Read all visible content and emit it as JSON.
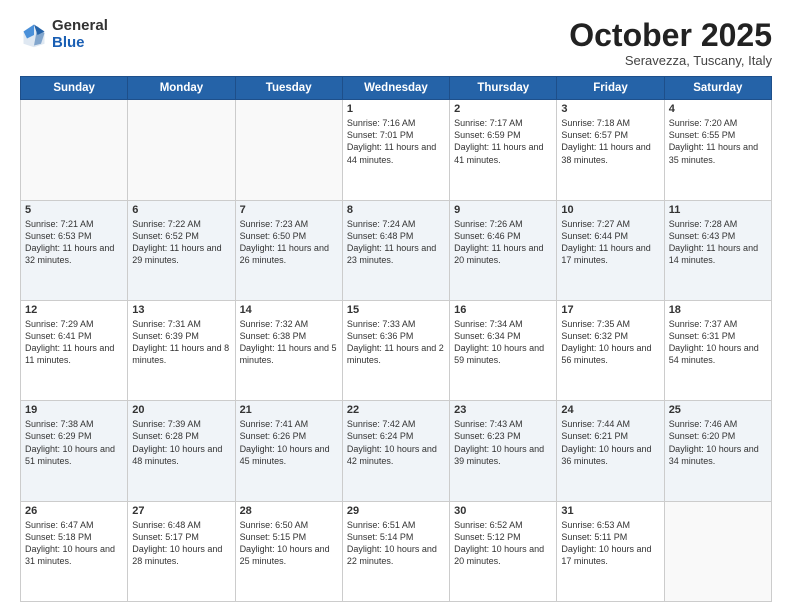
{
  "header": {
    "logo_general": "General",
    "logo_blue": "Blue",
    "month": "October 2025",
    "location": "Seravezza, Tuscany, Italy"
  },
  "weekdays": [
    "Sunday",
    "Monday",
    "Tuesday",
    "Wednesday",
    "Thursday",
    "Friday",
    "Saturday"
  ],
  "weeks": [
    [
      {
        "day": "",
        "info": ""
      },
      {
        "day": "",
        "info": ""
      },
      {
        "day": "",
        "info": ""
      },
      {
        "day": "1",
        "info": "Sunrise: 7:16 AM\nSunset: 7:01 PM\nDaylight: 11 hours and 44 minutes."
      },
      {
        "day": "2",
        "info": "Sunrise: 7:17 AM\nSunset: 6:59 PM\nDaylight: 11 hours and 41 minutes."
      },
      {
        "day": "3",
        "info": "Sunrise: 7:18 AM\nSunset: 6:57 PM\nDaylight: 11 hours and 38 minutes."
      },
      {
        "day": "4",
        "info": "Sunrise: 7:20 AM\nSunset: 6:55 PM\nDaylight: 11 hours and 35 minutes."
      }
    ],
    [
      {
        "day": "5",
        "info": "Sunrise: 7:21 AM\nSunset: 6:53 PM\nDaylight: 11 hours and 32 minutes."
      },
      {
        "day": "6",
        "info": "Sunrise: 7:22 AM\nSunset: 6:52 PM\nDaylight: 11 hours and 29 minutes."
      },
      {
        "day": "7",
        "info": "Sunrise: 7:23 AM\nSunset: 6:50 PM\nDaylight: 11 hours and 26 minutes."
      },
      {
        "day": "8",
        "info": "Sunrise: 7:24 AM\nSunset: 6:48 PM\nDaylight: 11 hours and 23 minutes."
      },
      {
        "day": "9",
        "info": "Sunrise: 7:26 AM\nSunset: 6:46 PM\nDaylight: 11 hours and 20 minutes."
      },
      {
        "day": "10",
        "info": "Sunrise: 7:27 AM\nSunset: 6:44 PM\nDaylight: 11 hours and 17 minutes."
      },
      {
        "day": "11",
        "info": "Sunrise: 7:28 AM\nSunset: 6:43 PM\nDaylight: 11 hours and 14 minutes."
      }
    ],
    [
      {
        "day": "12",
        "info": "Sunrise: 7:29 AM\nSunset: 6:41 PM\nDaylight: 11 hours and 11 minutes."
      },
      {
        "day": "13",
        "info": "Sunrise: 7:31 AM\nSunset: 6:39 PM\nDaylight: 11 hours and 8 minutes."
      },
      {
        "day": "14",
        "info": "Sunrise: 7:32 AM\nSunset: 6:38 PM\nDaylight: 11 hours and 5 minutes."
      },
      {
        "day": "15",
        "info": "Sunrise: 7:33 AM\nSunset: 6:36 PM\nDaylight: 11 hours and 2 minutes."
      },
      {
        "day": "16",
        "info": "Sunrise: 7:34 AM\nSunset: 6:34 PM\nDaylight: 10 hours and 59 minutes."
      },
      {
        "day": "17",
        "info": "Sunrise: 7:35 AM\nSunset: 6:32 PM\nDaylight: 10 hours and 56 minutes."
      },
      {
        "day": "18",
        "info": "Sunrise: 7:37 AM\nSunset: 6:31 PM\nDaylight: 10 hours and 54 minutes."
      }
    ],
    [
      {
        "day": "19",
        "info": "Sunrise: 7:38 AM\nSunset: 6:29 PM\nDaylight: 10 hours and 51 minutes."
      },
      {
        "day": "20",
        "info": "Sunrise: 7:39 AM\nSunset: 6:28 PM\nDaylight: 10 hours and 48 minutes."
      },
      {
        "day": "21",
        "info": "Sunrise: 7:41 AM\nSunset: 6:26 PM\nDaylight: 10 hours and 45 minutes."
      },
      {
        "day": "22",
        "info": "Sunrise: 7:42 AM\nSunset: 6:24 PM\nDaylight: 10 hours and 42 minutes."
      },
      {
        "day": "23",
        "info": "Sunrise: 7:43 AM\nSunset: 6:23 PM\nDaylight: 10 hours and 39 minutes."
      },
      {
        "day": "24",
        "info": "Sunrise: 7:44 AM\nSunset: 6:21 PM\nDaylight: 10 hours and 36 minutes."
      },
      {
        "day": "25",
        "info": "Sunrise: 7:46 AM\nSunset: 6:20 PM\nDaylight: 10 hours and 34 minutes."
      }
    ],
    [
      {
        "day": "26",
        "info": "Sunrise: 6:47 AM\nSunset: 5:18 PM\nDaylight: 10 hours and 31 minutes."
      },
      {
        "day": "27",
        "info": "Sunrise: 6:48 AM\nSunset: 5:17 PM\nDaylight: 10 hours and 28 minutes."
      },
      {
        "day": "28",
        "info": "Sunrise: 6:50 AM\nSunset: 5:15 PM\nDaylight: 10 hours and 25 minutes."
      },
      {
        "day": "29",
        "info": "Sunrise: 6:51 AM\nSunset: 5:14 PM\nDaylight: 10 hours and 22 minutes."
      },
      {
        "day": "30",
        "info": "Sunrise: 6:52 AM\nSunset: 5:12 PM\nDaylight: 10 hours and 20 minutes."
      },
      {
        "day": "31",
        "info": "Sunrise: 6:53 AM\nSunset: 5:11 PM\nDaylight: 10 hours and 17 minutes."
      },
      {
        "day": "",
        "info": ""
      }
    ]
  ]
}
